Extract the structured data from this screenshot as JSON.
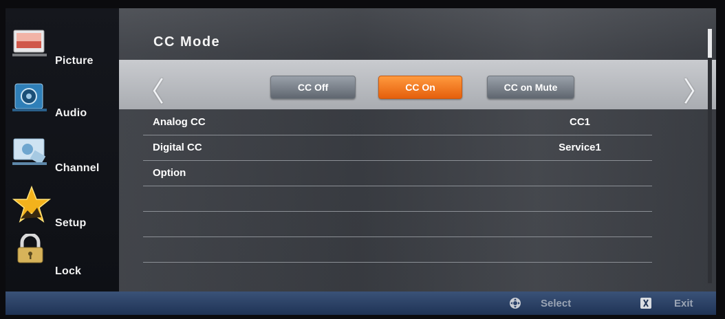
{
  "sidebar": {
    "items": [
      {
        "label": "Picture",
        "icon": "picture-icon"
      },
      {
        "label": "Audio",
        "icon": "audio-icon"
      },
      {
        "label": "Channel",
        "icon": "channel-icon"
      },
      {
        "label": "Setup",
        "icon": "setup-star-icon"
      },
      {
        "label": "Lock",
        "icon": "lock-icon"
      }
    ],
    "selected": "Setup"
  },
  "main": {
    "title": "CC Mode",
    "mode_options": [
      "CC Off",
      "CC On",
      "CC on Mute"
    ],
    "selected_mode": "CC On",
    "rows": [
      {
        "label": "Analog CC",
        "value": "CC1"
      },
      {
        "label": "Digital CC",
        "value": "Service1"
      },
      {
        "label": "Option",
        "value": ""
      },
      {
        "label": "",
        "value": ""
      },
      {
        "label": "",
        "value": ""
      },
      {
        "label": "",
        "value": ""
      }
    ]
  },
  "footer": {
    "select_label": "Select",
    "exit_label": "Exit"
  },
  "colors": {
    "accent": "#f07a22",
    "footer": "#2c426a",
    "panel": "#3c3f45"
  }
}
